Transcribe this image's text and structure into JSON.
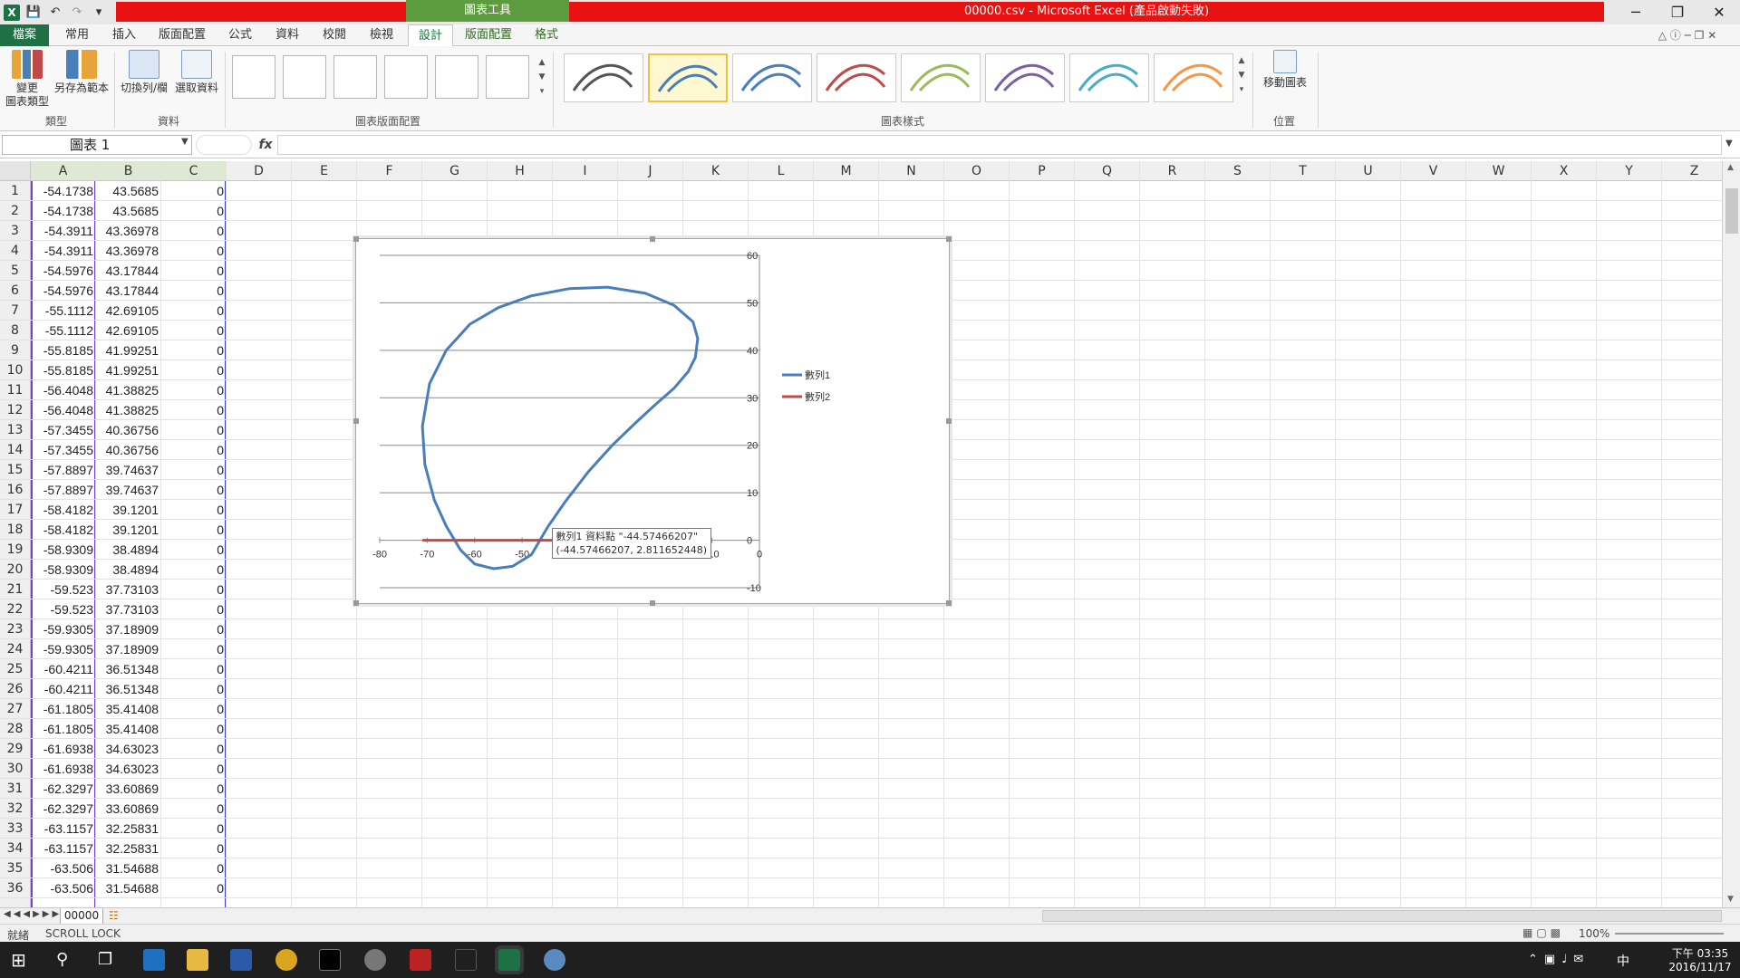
{
  "window": {
    "title": "00000.csv - Microsoft Excel (產品啟動失敗)",
    "context_tab_group": "圖表工具",
    "buttons": [
      "─",
      "❐",
      "✕"
    ]
  },
  "ribbon_tabs": [
    "檔案",
    "常用",
    "插入",
    "版面配置",
    "公式",
    "資料",
    "校閱",
    "檢視",
    "設計",
    "版面配置",
    "格式"
  ],
  "ribbon": {
    "groups": [
      {
        "label": "類型",
        "buttons": [
          "變更\n圖表類型",
          "另存為範本"
        ]
      },
      {
        "label": "資料",
        "buttons": [
          "切換列/欄",
          "選取資料"
        ]
      },
      {
        "label": "圖表版面配置"
      },
      {
        "label": "圖表樣式"
      },
      {
        "label": "位置",
        "buttons": [
          "移動圖表"
        ]
      }
    ],
    "style_colors": [
      "#555555",
      "#4a7ebb",
      "#4a7ebb",
      "#be4b48",
      "#9bbb59",
      "#7d60a0",
      "#4bacc6",
      "#f79646"
    ]
  },
  "formula_bar": {
    "name_box": "圖表 1",
    "fx": "fx",
    "value": ""
  },
  "columns": [
    "A",
    "B",
    "C",
    "D",
    "E",
    "F",
    "G",
    "H",
    "I",
    "J",
    "K",
    "L",
    "M",
    "N",
    "O",
    "P",
    "Q",
    "R",
    "S",
    "T",
    "U",
    "V",
    "W",
    "X",
    "Y",
    "Z"
  ],
  "rows": [
    [
      "1",
      "-54.1738",
      "43.5685",
      "0"
    ],
    [
      "2",
      "-54.1738",
      "43.5685",
      "0"
    ],
    [
      "3",
      "-54.3911",
      "43.36978",
      "0"
    ],
    [
      "4",
      "-54.3911",
      "43.36978",
      "0"
    ],
    [
      "5",
      "-54.5976",
      "43.17844",
      "0"
    ],
    [
      "6",
      "-54.5976",
      "43.17844",
      "0"
    ],
    [
      "7",
      "-55.1112",
      "42.69105",
      "0"
    ],
    [
      "8",
      "-55.1112",
      "42.69105",
      "0"
    ],
    [
      "9",
      "-55.8185",
      "41.99251",
      "0"
    ],
    [
      "10",
      "-55.8185",
      "41.99251",
      "0"
    ],
    [
      "11",
      "-56.4048",
      "41.38825",
      "0"
    ],
    [
      "12",
      "-56.4048",
      "41.38825",
      "0"
    ],
    [
      "13",
      "-57.3455",
      "40.36756",
      "0"
    ],
    [
      "14",
      "-57.3455",
      "40.36756",
      "0"
    ],
    [
      "15",
      "-57.8897",
      "39.74637",
      "0"
    ],
    [
      "16",
      "-57.8897",
      "39.74637",
      "0"
    ],
    [
      "17",
      "-58.4182",
      "39.1201",
      "0"
    ],
    [
      "18",
      "-58.4182",
      "39.1201",
      "0"
    ],
    [
      "19",
      "-58.9309",
      "38.4894",
      "0"
    ],
    [
      "20",
      "-58.9309",
      "38.4894",
      "0"
    ],
    [
      "21",
      "-59.523",
      "37.73103",
      "0"
    ],
    [
      "22",
      "-59.523",
      "37.73103",
      "0"
    ],
    [
      "23",
      "-59.9305",
      "37.18909",
      "0"
    ],
    [
      "24",
      "-59.9305",
      "37.18909",
      "0"
    ],
    [
      "25",
      "-60.4211",
      "36.51348",
      "0"
    ],
    [
      "26",
      "-60.4211",
      "36.51348",
      "0"
    ],
    [
      "27",
      "-61.1805",
      "35.41408",
      "0"
    ],
    [
      "28",
      "-61.1805",
      "35.41408",
      "0"
    ],
    [
      "29",
      "-61.6938",
      "34.63023",
      "0"
    ],
    [
      "30",
      "-61.6938",
      "34.63023",
      "0"
    ],
    [
      "31",
      "-62.3297",
      "33.60869",
      "0"
    ],
    [
      "32",
      "-62.3297",
      "33.60869",
      "0"
    ],
    [
      "33",
      "-63.1157",
      "32.25831",
      "0"
    ],
    [
      "34",
      "-63.1157",
      "32.25831",
      "0"
    ],
    [
      "35",
      "-63.506",
      "31.54688",
      "0"
    ],
    [
      "36",
      "-63.506",
      "31.54688",
      "0"
    ]
  ],
  "chart_data": {
    "type": "scatter",
    "xlim": [
      -80,
      0
    ],
    "ylim": [
      -10,
      60
    ],
    "xticks": [
      -80,
      -70,
      -60,
      -50,
      -40,
      -30,
      -20,
      -10,
      0
    ],
    "yticks": [
      -10,
      0,
      10,
      20,
      30,
      40,
      50,
      60
    ],
    "legend_position": "right",
    "series": [
      {
        "name": "數列1",
        "color": "#4a7ebb",
        "x": [
          -44.6,
          -41,
          -36,
          -31,
          -26,
          -22,
          -18,
          -15,
          -13.5,
          -13,
          -14,
          -18,
          -24,
          -32,
          -40,
          -48,
          -55,
          -61,
          -66,
          -69.5,
          -71,
          -70.5,
          -68.5,
          -66,
          -63,
          -60,
          -56,
          -52,
          -48,
          -44.6
        ],
        "y": [
          2.8,
          8,
          14.5,
          20,
          24.8,
          28.5,
          32,
          35.5,
          38.5,
          42.5,
          46,
          49.5,
          52,
          53.3,
          53,
          51.5,
          49,
          45.5,
          40,
          33,
          24,
          16,
          8.5,
          3,
          -2,
          -5,
          -6,
          -5.5,
          -3,
          2.8
        ]
      },
      {
        "name": "數列2",
        "color": "#be4b48",
        "x": [
          -71,
          -13
        ],
        "y": [
          0,
          0
        ]
      }
    ],
    "tooltip": {
      "line1": "數列1 資料點 \"-44.57466207\"",
      "line2": "(-44.57466207, 2.811652448)",
      "x": -44.57466207,
      "y": 2.811652448
    }
  },
  "sheet": {
    "tab": "00000"
  },
  "status": {
    "left": "就緒",
    "scroll_lock": "SCROLL LOCK",
    "zoom": "100%"
  },
  "taskbar": {
    "time": "下午 03:35",
    "date": "2016/11/17",
    "ime": "中"
  }
}
